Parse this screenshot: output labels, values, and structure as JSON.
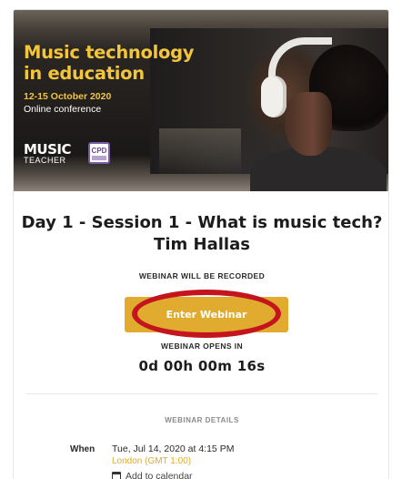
{
  "hero": {
    "title_line1": "Music technology",
    "title_line2": "in education",
    "dates": "12-15 October 2020",
    "subtitle": "Online conference",
    "logo_music": "MUSIC",
    "logo_teacher": "TEACHER",
    "badge_text": "CPD"
  },
  "session": {
    "title": "Day 1 - Session 1 - What is music tech? Tim Hallas",
    "recorded_notice": "WEBINAR WILL BE RECORDED",
    "enter_button": "Enter Webinar",
    "opens_label": "WEBINAR OPENS IN",
    "countdown": "0d 00h 00m 16s"
  },
  "details": {
    "heading": "WEBINAR DETAILS",
    "when_label": "When",
    "date": "Tue, Jul 14, 2020 at 4:15 PM",
    "timezone": "London (GMT 1:00)",
    "add_to_calendar": "Add to calendar"
  },
  "colors": {
    "accent": "#e0ab2f",
    "highlight_ring": "#c4141e",
    "hero_title": "#f2c53d"
  }
}
